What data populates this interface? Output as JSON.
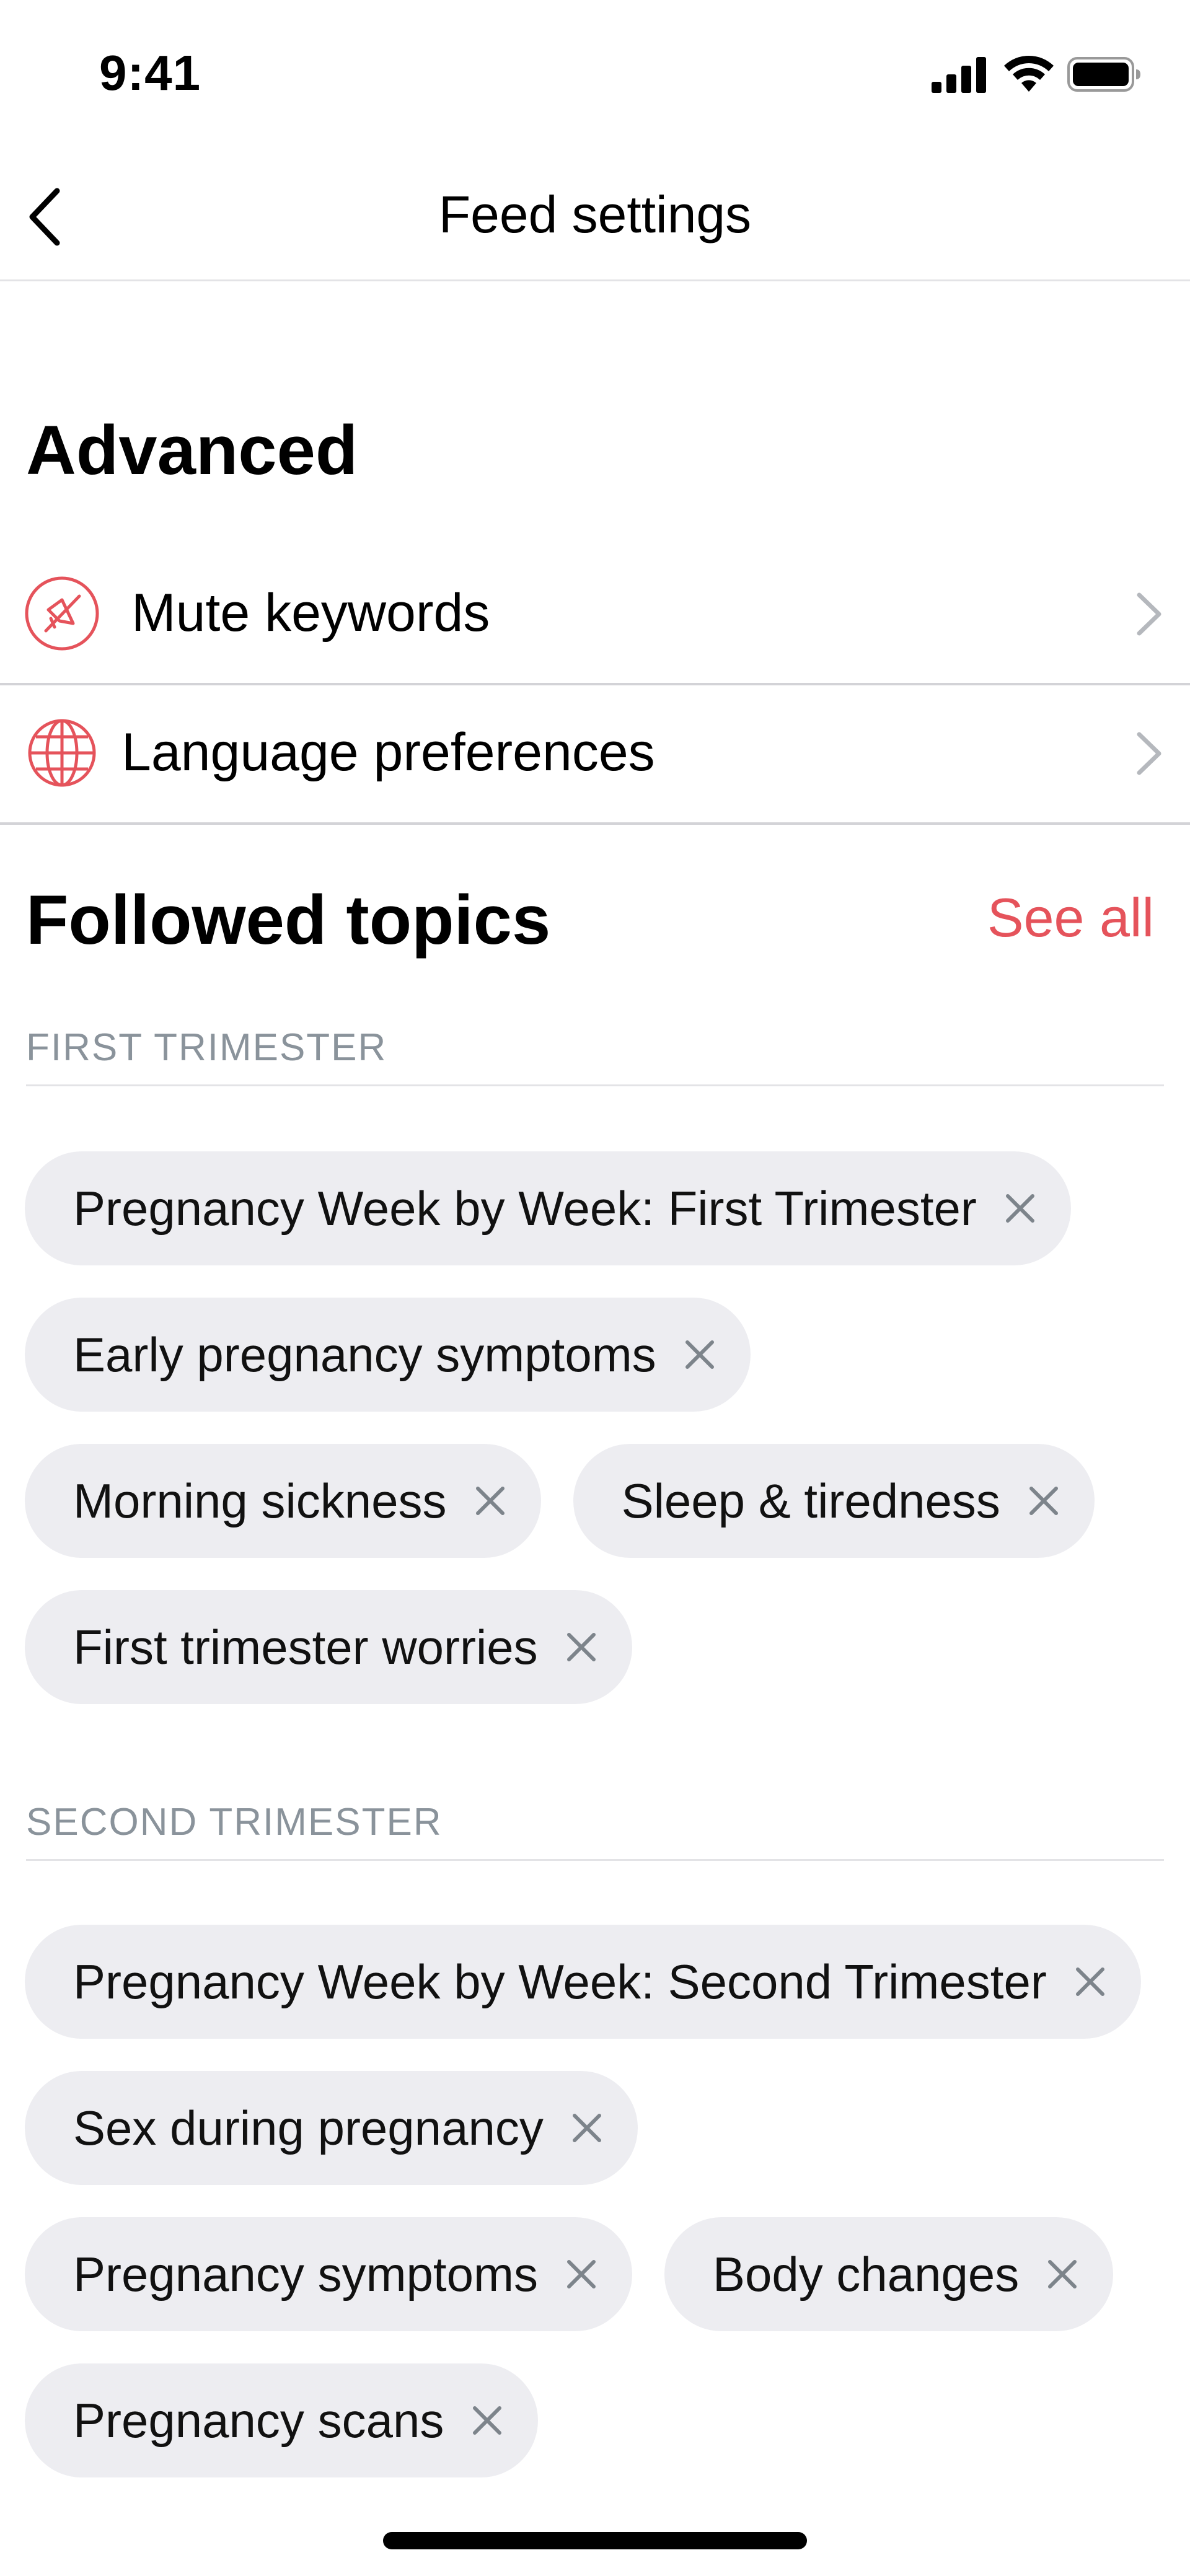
{
  "status_bar": {
    "time": "9:41"
  },
  "nav": {
    "title": "Feed settings"
  },
  "advanced": {
    "title": "Advanced",
    "items": [
      {
        "label": "Mute keywords",
        "icon": "mute-megaphone-icon"
      },
      {
        "label": "Language preferences",
        "icon": "globe-icon"
      }
    ]
  },
  "followed": {
    "title": "Followed topics",
    "see_all": "See all",
    "sections": [
      {
        "heading": "FIRST TRIMESTER",
        "topics": [
          "Pregnancy Week by Week: First Trimester",
          "Early pregnancy symptoms",
          "Morning sickness",
          "Sleep & tiredness",
          "First trimester worries"
        ]
      },
      {
        "heading": "SECOND TRIMESTER",
        "topics": [
          "Pregnancy Week by Week: Second Trimester",
          "Sex during pregnancy",
          "Pregnancy symptoms",
          "Body changes",
          "Pregnancy scans"
        ]
      }
    ]
  },
  "colors": {
    "accent": "#e5535b",
    "chip_bg": "#ededf1",
    "muted_text": "#8a939b"
  }
}
